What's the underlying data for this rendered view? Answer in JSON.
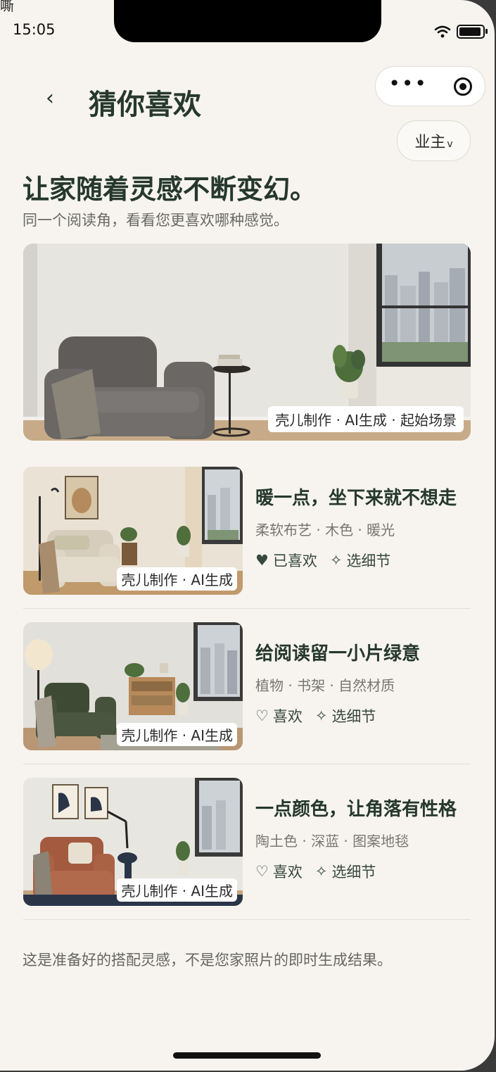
{
  "status_bar": {
    "time": "15:05",
    "stray_text": "嘶"
  },
  "header": {
    "back_glyph": "‹",
    "title": "猜你喜欢",
    "role_label": "业主",
    "role_caret": "v"
  },
  "intro": {
    "headline": "让家随着灵感不断变幻。",
    "subline": "同一个阅读角，看看您更喜欢哪种感觉。"
  },
  "hero": {
    "tag": "壳儿制作 · AI生成 · 起始场景"
  },
  "cards": [
    {
      "title": "暖一点，坐下来就不想走",
      "tags": "柔软布艺 · 木色 · 暖光",
      "like_icon": "♥",
      "like_label": "已喜欢",
      "detail_icon": "✧",
      "detail_label": "选细节",
      "image_tag": "壳儿制作 · AI生成",
      "liked": true
    },
    {
      "title": "给阅读留一小片绿意",
      "tags": "植物 · 书架 · 自然材质",
      "like_icon": "♡",
      "like_label": "喜欢",
      "detail_icon": "✧",
      "detail_label": "选细节",
      "image_tag": "壳儿制作 · AI生成",
      "liked": false
    },
    {
      "title": "一点颜色，让角落有性格",
      "tags": "陶土色 · 深蓝 · 图案地毯",
      "like_icon": "♡",
      "like_label": "喜欢",
      "detail_icon": "✧",
      "detail_label": "选细节",
      "image_tag": "壳儿制作 · AI生成",
      "liked": false
    }
  ],
  "footer_note": "这是准备好的搭配灵感，不是您家照片的即时生成结果。",
  "colors": {
    "accent": "#26382e",
    "background": "#f7f4ef",
    "muted": "#77776e"
  }
}
